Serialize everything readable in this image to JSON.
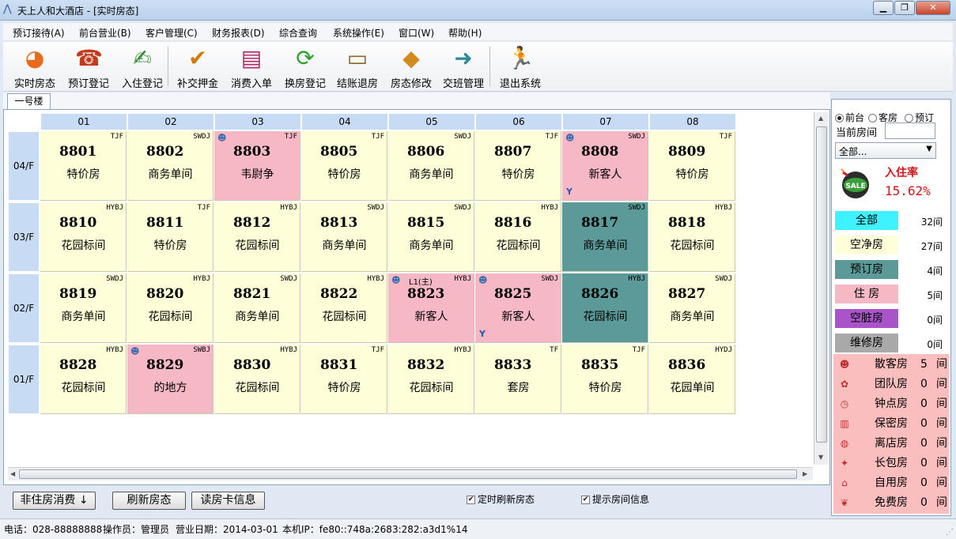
{
  "window": {
    "title": "天上人和大酒店 - [实时房态]",
    "minimize": "▁",
    "restore": "❐",
    "close": "✕"
  },
  "menu": [
    "预订接待(A)",
    "前台营业(B)",
    "客户管理(C)",
    "财务报表(D)",
    "综合查询",
    "系统操作(E)",
    "窗口(W)",
    "帮助(H)"
  ],
  "toolbar": [
    {
      "label": "实时房态",
      "icon": "pie-chart-icon",
      "glyph": "◕"
    },
    {
      "label": "预订登记",
      "icon": "telephone-icon",
      "glyph": "☎"
    },
    {
      "label": "入住登记",
      "icon": "pen-user-icon",
      "glyph": "✍"
    },
    {
      "label": "补交押金",
      "icon": "check-pen-icon",
      "glyph": "✔"
    },
    {
      "label": "消费入单",
      "icon": "books-icon",
      "glyph": "▤"
    },
    {
      "label": "换房登记",
      "icon": "swap-arrows-icon",
      "glyph": "⟳"
    },
    {
      "label": "结账退房",
      "icon": "card-icon",
      "glyph": "▭"
    },
    {
      "label": "房态修改",
      "icon": "person-edit-icon",
      "glyph": "◆"
    },
    {
      "label": "交班管理",
      "icon": "signpost-icon",
      "glyph": "➜"
    },
    {
      "label": "退出系统",
      "icon": "running-man-icon",
      "glyph": "🏃"
    }
  ],
  "tab": "一号楼",
  "columns": [
    "01",
    "02",
    "03",
    "04",
    "05",
    "06",
    "07",
    "08"
  ],
  "floors": [
    {
      "label": "04/F",
      "rooms": [
        {
          "num": "8801",
          "type": "特价房",
          "code": "TJF",
          "status": "clean"
        },
        {
          "num": "8802",
          "type": "商务单间",
          "code": "SWDJ",
          "status": "clean"
        },
        {
          "num": "8803",
          "type": "韦尉争",
          "code": "TJF",
          "status": "occupied",
          "guest": true
        },
        {
          "num": "8805",
          "type": "特价房",
          "code": "TJF",
          "status": "clean"
        },
        {
          "num": "8806",
          "type": "商务单间",
          "code": "SWDJ",
          "status": "clean"
        },
        {
          "num": "8807",
          "type": "特价房",
          "code": "TJF",
          "status": "clean"
        },
        {
          "num": "8808",
          "type": "新客人",
          "code": "SWDJ",
          "status": "occupied",
          "guest": true,
          "flag": "Y"
        },
        {
          "num": "8809",
          "type": "特价房",
          "code": "TJF",
          "status": "clean"
        }
      ]
    },
    {
      "label": "03/F",
      "rooms": [
        {
          "num": "8810",
          "type": "花园标间",
          "code": "HYBJ",
          "status": "clean"
        },
        {
          "num": "8811",
          "type": "特价房",
          "code": "TJF",
          "status": "clean"
        },
        {
          "num": "8812",
          "type": "花园标间",
          "code": "HYBJ",
          "status": "clean"
        },
        {
          "num": "8813",
          "type": "商务单间",
          "code": "SWDJ",
          "status": "clean"
        },
        {
          "num": "8815",
          "type": "商务单间",
          "code": "SWDJ",
          "status": "clean"
        },
        {
          "num": "8816",
          "type": "花园标间",
          "code": "HYBJ",
          "status": "clean"
        },
        {
          "num": "8817",
          "type": "商务单间",
          "code": "SWDJ",
          "status": "reserved"
        },
        {
          "num": "8818",
          "type": "花园标间",
          "code": "HYBJ",
          "status": "clean"
        }
      ]
    },
    {
      "label": "02/F",
      "rooms": [
        {
          "num": "8819",
          "type": "商务单间",
          "code": "SWDJ",
          "status": "clean"
        },
        {
          "num": "8820",
          "type": "花园标间",
          "code": "HYBJ",
          "status": "clean"
        },
        {
          "num": "8821",
          "type": "商务单间",
          "code": "SWDJ",
          "status": "clean"
        },
        {
          "num": "8822",
          "type": "花园标间",
          "code": "HYBJ",
          "status": "clean"
        },
        {
          "num": "8823",
          "type": "新客人",
          "code": "HYBJ",
          "status": "occupied",
          "guest": true,
          "prefix": "L1(主)"
        },
        {
          "num": "8825",
          "type": "新客人",
          "code": "SWDJ",
          "status": "occupied",
          "guest": true,
          "flag": "Y"
        },
        {
          "num": "8826",
          "type": "花园标间",
          "code": "HYBJ",
          "status": "reserved"
        },
        {
          "num": "8827",
          "type": "商务单间",
          "code": "SWDJ",
          "status": "clean"
        }
      ]
    },
    {
      "label": "01/F",
      "rooms": [
        {
          "num": "8828",
          "type": "花园标间",
          "code": "HYBJ",
          "status": "clean"
        },
        {
          "num": "8829",
          "type": "的地方",
          "code": "SWBJ",
          "status": "occupied",
          "guest": true
        },
        {
          "num": "8830",
          "type": "花园标间",
          "code": "HYBJ",
          "status": "clean"
        },
        {
          "num": "8831",
          "type": "特价房",
          "code": "TJF",
          "status": "clean"
        },
        {
          "num": "8832",
          "type": "花园标间",
          "code": "HYBJ",
          "status": "clean"
        },
        {
          "num": "8833",
          "type": "套房",
          "code": "TF",
          "status": "clean"
        },
        {
          "num": "8835",
          "type": "特价房",
          "code": "TJF",
          "status": "clean"
        },
        {
          "num": "8836",
          "type": "花园单间",
          "code": "HYDJ",
          "status": "clean"
        }
      ]
    }
  ],
  "status_colors": {
    "clean": "#fefed9",
    "occupied": "#f6b8c4",
    "reserved": "#5b9a98"
  },
  "bottom": {
    "btn_nonguest": "非住房消费",
    "btn_nonguest_arrow": "↓",
    "btn_refresh": "刷新房态",
    "btn_readcard": "读房卡信息",
    "chk_timer": "定时刷新房态",
    "chk_hint": "提示房间信息"
  },
  "status": {
    "phone": "电话：028-88888888",
    "operator": "操作员：管理员",
    "date": "营业日期：2014-03-01",
    "ip": "本机IP：fe80::748a:2683:282:a3d1%14"
  },
  "side": {
    "radios": [
      "前台",
      "客房",
      "预订"
    ],
    "current_room_label": "当前房间",
    "current_room_value": "",
    "select_value": "全部...",
    "occupancy_label": "入住率",
    "occupancy_value": "15.62%",
    "sale_text": "SALE",
    "legend": [
      {
        "label": "全部",
        "count": "32间",
        "color": "#3ff2ff"
      },
      {
        "label": "空净房",
        "count": "27间",
        "color": "#fefed9"
      },
      {
        "label": "预订房",
        "count": "4间",
        "color": "#5b9a98"
      },
      {
        "label": "住  房",
        "count": "5间",
        "color": "#f6b8c4"
      },
      {
        "label": "空脏房",
        "count": "0间",
        "color": "#a855c9"
      },
      {
        "label": "维修房",
        "count": "0间",
        "color": "#a9a9a9"
      }
    ],
    "categories": [
      {
        "label": "散客房",
        "count": "5",
        "unit": "间",
        "icon": "person-icon",
        "glyph": "☻"
      },
      {
        "label": "团队房",
        "count": "0",
        "unit": "间",
        "icon": "ribbon-icon",
        "glyph": "✿"
      },
      {
        "label": "钟点房",
        "count": "0",
        "unit": "间",
        "icon": "clock-icon",
        "glyph": "◷"
      },
      {
        "label": "保密房",
        "count": "0",
        "unit": "间",
        "icon": "curtain-icon",
        "glyph": "▥"
      },
      {
        "label": "离店房",
        "count": "0",
        "unit": "间",
        "icon": "globe-icon",
        "glyph": "◍"
      },
      {
        "label": "长包房",
        "count": "0",
        "unit": "间",
        "icon": "bulb-icon",
        "glyph": "✦"
      },
      {
        "label": "自用房",
        "count": "0",
        "unit": "间",
        "icon": "house-icon",
        "glyph": "⌂"
      },
      {
        "label": "免费房",
        "count": "0",
        "unit": "间",
        "icon": "gift-icon",
        "glyph": "❦"
      }
    ]
  }
}
